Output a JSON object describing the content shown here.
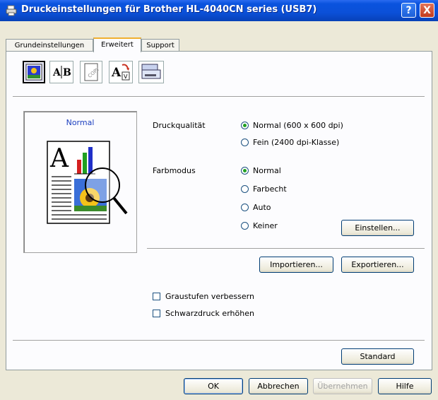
{
  "window": {
    "title": "Druckeinstellungen für Brother HL-4040CN series (USB7)",
    "help_btn": "?",
    "close_btn": "X"
  },
  "tabs": [
    {
      "label": "Grundeinstellungen",
      "active": false
    },
    {
      "label": "Erweitert",
      "active": true
    },
    {
      "label": "Support",
      "active": false
    }
  ],
  "toolbar_icons": [
    "color-quality-icon",
    "duplex-icon",
    "watermark-icon",
    "page-setting-icon",
    "device-options-icon"
  ],
  "preview": {
    "label": "Normal"
  },
  "print_quality": {
    "label": "Druckqualität",
    "options": [
      "Normal (600 x 600 dpi)",
      "Fein (2400 dpi-Klasse)"
    ],
    "selected": "Normal (600 x 600 dpi)"
  },
  "color_mode": {
    "label": "Farbmodus",
    "options": [
      "Normal",
      "Farbecht",
      "Auto",
      "Keiner"
    ],
    "selected": "Normal",
    "settings_button": "Einstellen..."
  },
  "import_button": "Importieren...",
  "export_button": "Exportieren...",
  "checkboxes": [
    {
      "label": "Graustufen verbessern",
      "checked": false
    },
    {
      "label": "Schwarzdruck erhöhen",
      "checked": false
    }
  ],
  "default_button": "Standard",
  "footer": {
    "ok": "OK",
    "cancel": "Abbrechen",
    "apply": "Übernehmen",
    "help": "Hilfe"
  }
}
